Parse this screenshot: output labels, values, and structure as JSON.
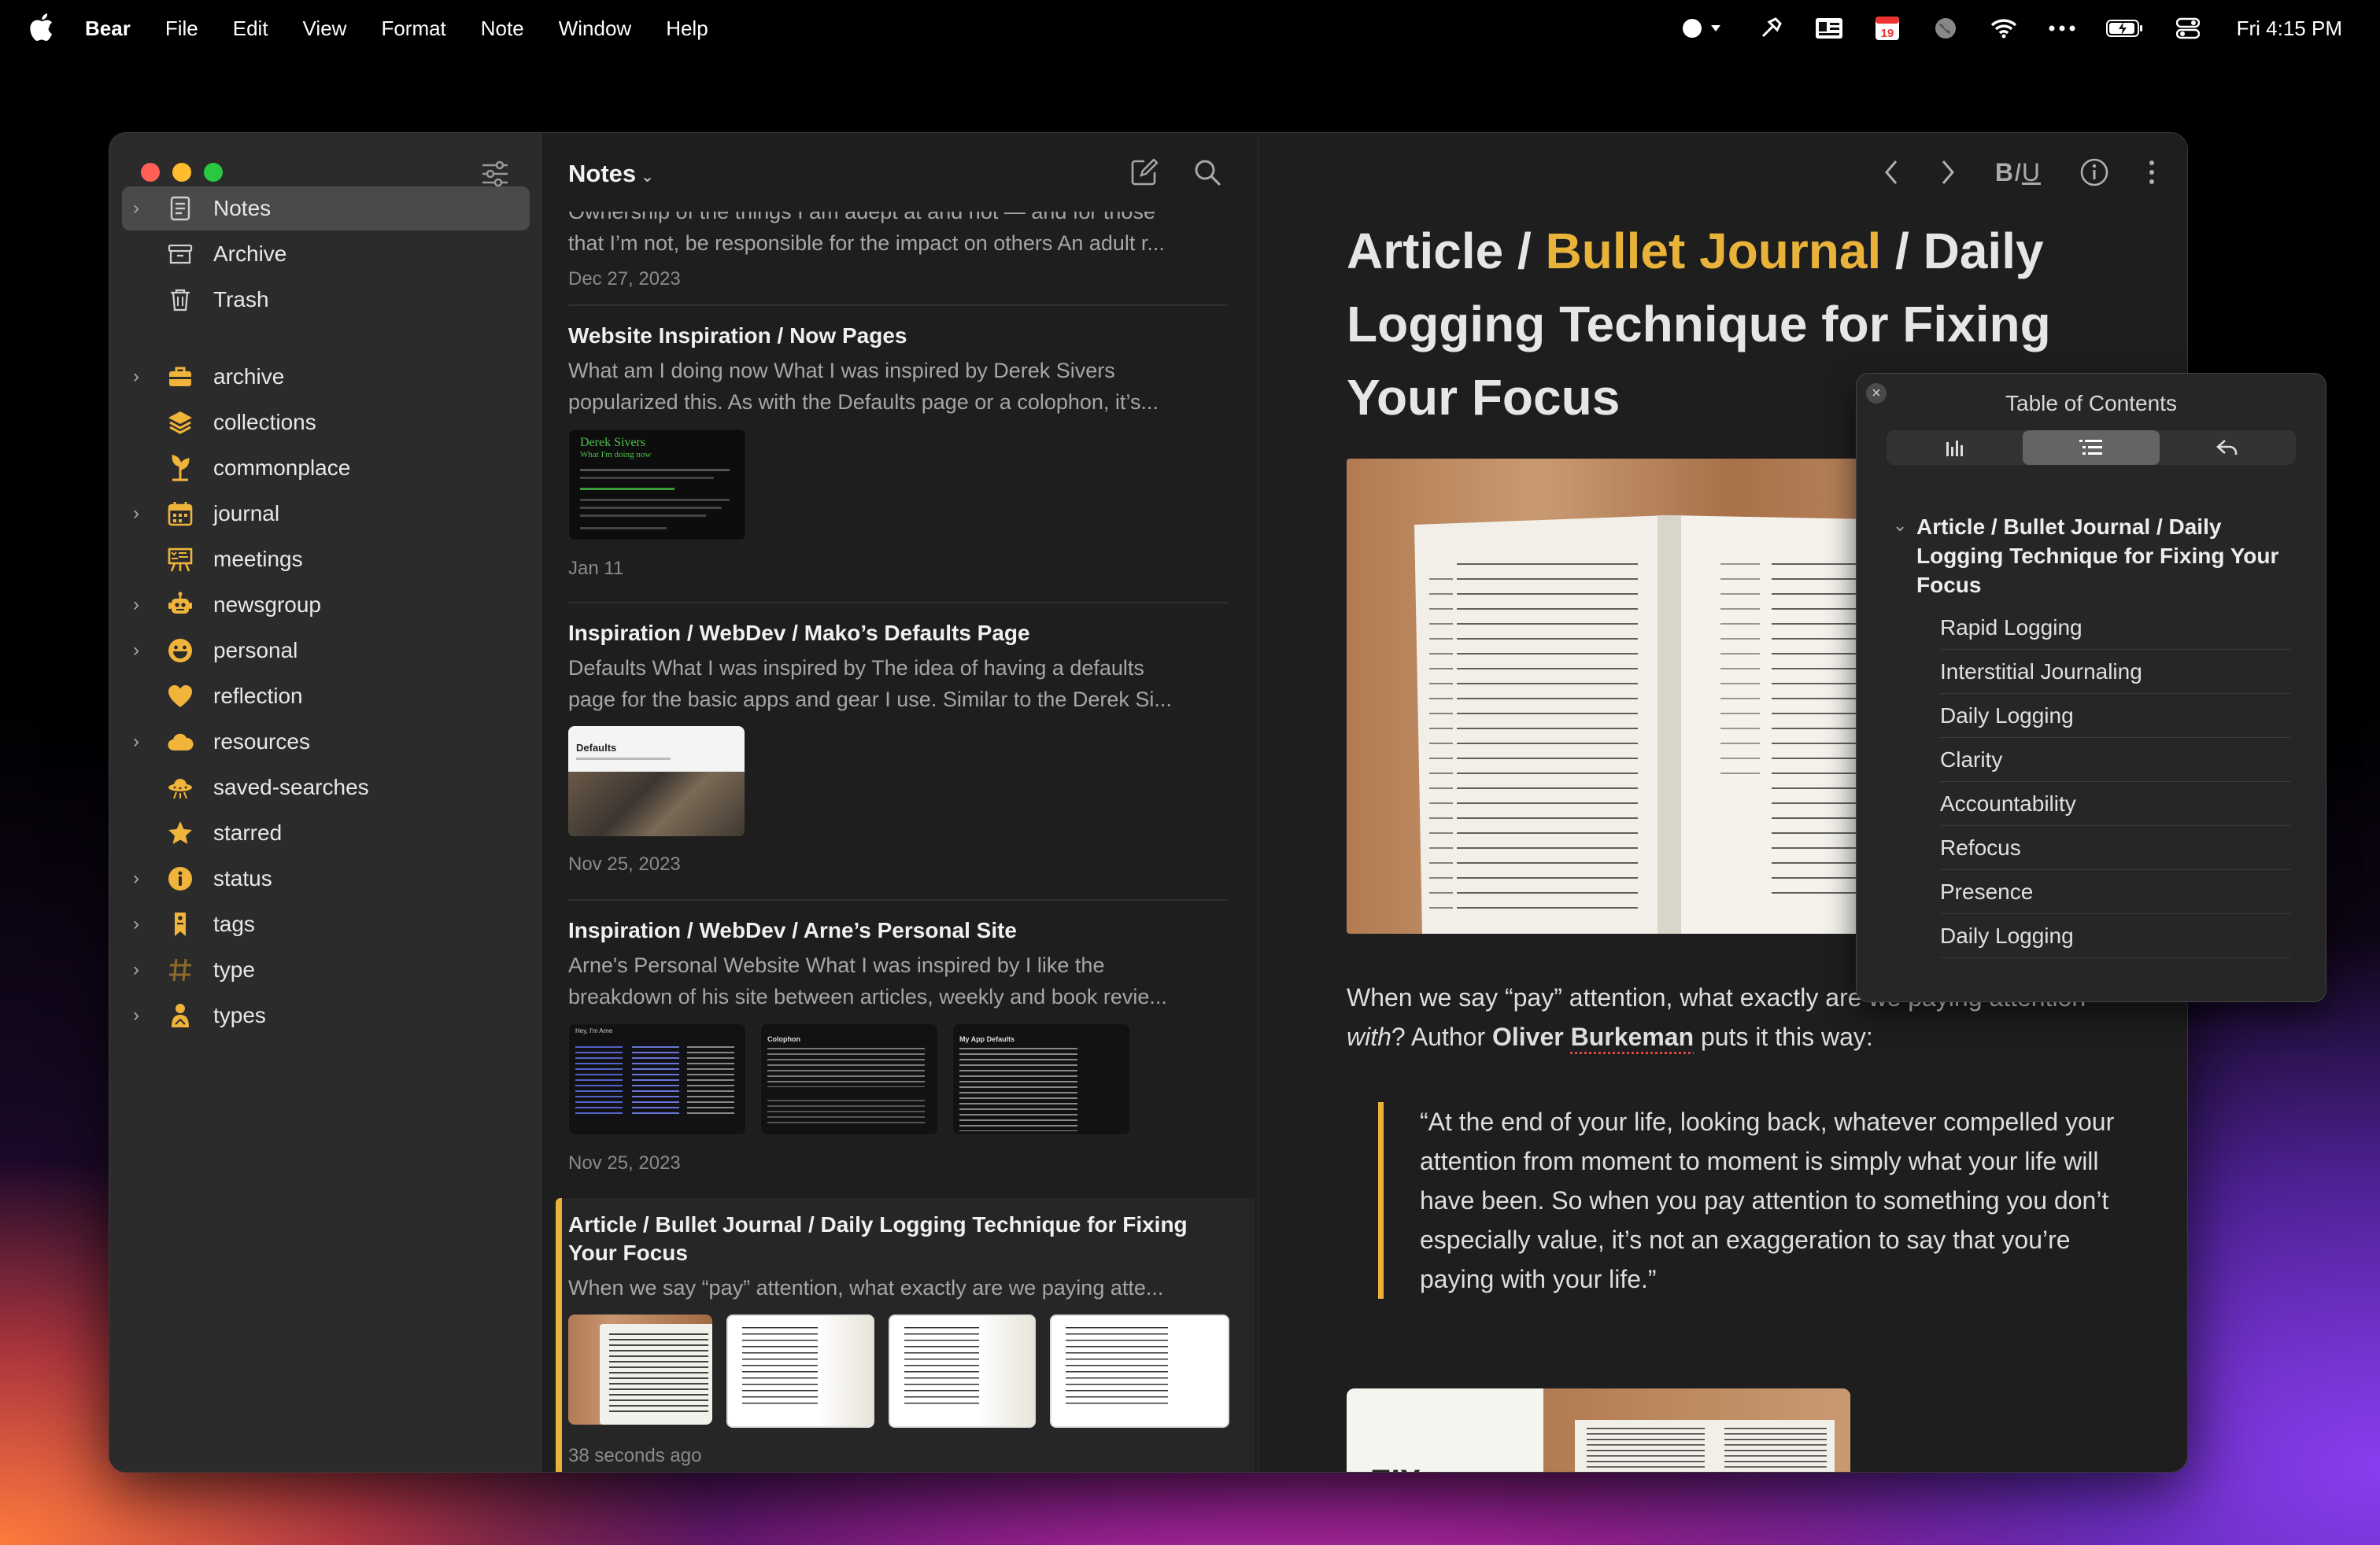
{
  "menubar": {
    "app_name": "Bear",
    "menus": [
      "File",
      "Edit",
      "View",
      "Format",
      "Note",
      "Window",
      "Help"
    ],
    "calendar_day": "19",
    "clock": "Fri 4:15 PM"
  },
  "sidebar": {
    "items": [
      {
        "label": "Notes",
        "icon": "notes-icon",
        "chevron": true,
        "selected": true
      },
      {
        "label": "Archive",
        "icon": "archive-box-icon",
        "chevron": false
      },
      {
        "label": "Trash",
        "icon": "trash-icon",
        "chevron": false
      },
      {
        "label": "archive",
        "icon": "briefcase-icon",
        "chevron": true
      },
      {
        "label": "collections",
        "icon": "layers-icon",
        "chevron": false
      },
      {
        "label": "commonplace",
        "icon": "plant-icon",
        "chevron": false
      },
      {
        "label": "journal",
        "icon": "calendar-icon",
        "chevron": true
      },
      {
        "label": "meetings",
        "icon": "easel-icon",
        "chevron": false
      },
      {
        "label": "newsgroup",
        "icon": "robot-icon",
        "chevron": true
      },
      {
        "label": "personal",
        "icon": "smiley-icon",
        "chevron": true
      },
      {
        "label": "reflection",
        "icon": "heart-icon",
        "chevron": false
      },
      {
        "label": "resources",
        "icon": "cloud-icon",
        "chevron": true
      },
      {
        "label": "saved-searches",
        "icon": "ufo-icon",
        "chevron": false
      },
      {
        "label": "starred",
        "icon": "star-icon",
        "chevron": false
      },
      {
        "label": "status",
        "icon": "info-icon",
        "chevron": true
      },
      {
        "label": "tags",
        "icon": "tag-icon",
        "chevron": true
      },
      {
        "label": "type",
        "icon": "hashtag-icon",
        "chevron": true
      },
      {
        "label": "types",
        "icon": "person-icon",
        "chevron": true
      }
    ]
  },
  "list": {
    "title": "Notes",
    "notes": [
      {
        "title": "",
        "snippet": "Ownership of the things I am adept at and not — and for those",
        "snippet2": "that I’m not, be responsible for the impact on others An adult r...",
        "date": "Dec 27, 2023"
      },
      {
        "title": "Website Inspiration / Now Pages",
        "snippet": "What am I doing now What I was inspired by Derek Sivers",
        "snippet2": "popularized this. As with the Defaults page or a colophon, it’s...",
        "date": "Jan 11",
        "thumb_heading": "Derek Sivers",
        "thumb_sub": "What I'm doing now"
      },
      {
        "title": "Inspiration / WebDev / Mako’s Defaults Page",
        "snippet": "Defaults What I was inspired by The idea of having a defaults",
        "snippet2": "page for the basic apps and gear I use. Similar to the Derek Si...",
        "date": "Nov 25, 2023",
        "thumb_heading": "Defaults"
      },
      {
        "title": "Inspiration / WebDev / Arne’s Personal Site",
        "snippet": "Arne's Personal Website What I was inspired by I like the",
        "snippet2": "breakdown of his site between articles, weekly and book revie...",
        "date": "Nov 25, 2023",
        "thumb_headings": [
          "Hey, I'm Arne",
          "Colophon",
          "My App Defaults"
        ]
      },
      {
        "title": "Article / Bullet Journal / Daily Logging Technique for Fixing Your Focus",
        "snippet": "When we say “pay” attention, what exactly are we paying atte...",
        "date": "38 seconds ago"
      }
    ]
  },
  "editor": {
    "toolbar": {
      "biu": "BIU"
    },
    "title_part1": "Article / ",
    "title_accent": "Bullet Journal",
    "title_part2": " / Daily Logging Technique for Fixing Your Focus",
    "body_1": "When we say “pay” attention, what exactly are we paying attention ",
    "body_with": "with",
    "body_2": "? Author ",
    "body_author_first": "Oliver ",
    "body_author_last": "Burkeman",
    "body_3": " puts it this way:",
    "quote": "“At the end of your life, looking back, whatever compelled your attention from moment to moment is simply what your life will have been. So when you pay attention to something you don’t especially value, it’s not an exaggeration to say that you’re paying with your life.”",
    "bottom_image_text": "EIX"
  },
  "toc": {
    "title": "Table of Contents",
    "heading": "Article / Bullet Journal / Daily Logging Technique for Fixing Your Focus",
    "items": [
      "Rapid Logging",
      "Interstitial Journaling",
      "Daily Logging",
      "Clarity",
      "Accountability",
      "Refocus",
      "Presence",
      "Daily Logging"
    ]
  },
  "colors": {
    "accent": "#e9b33a",
    "sidebar_bg": "#2b2b2c",
    "window_bg": "#1e1e1e"
  }
}
